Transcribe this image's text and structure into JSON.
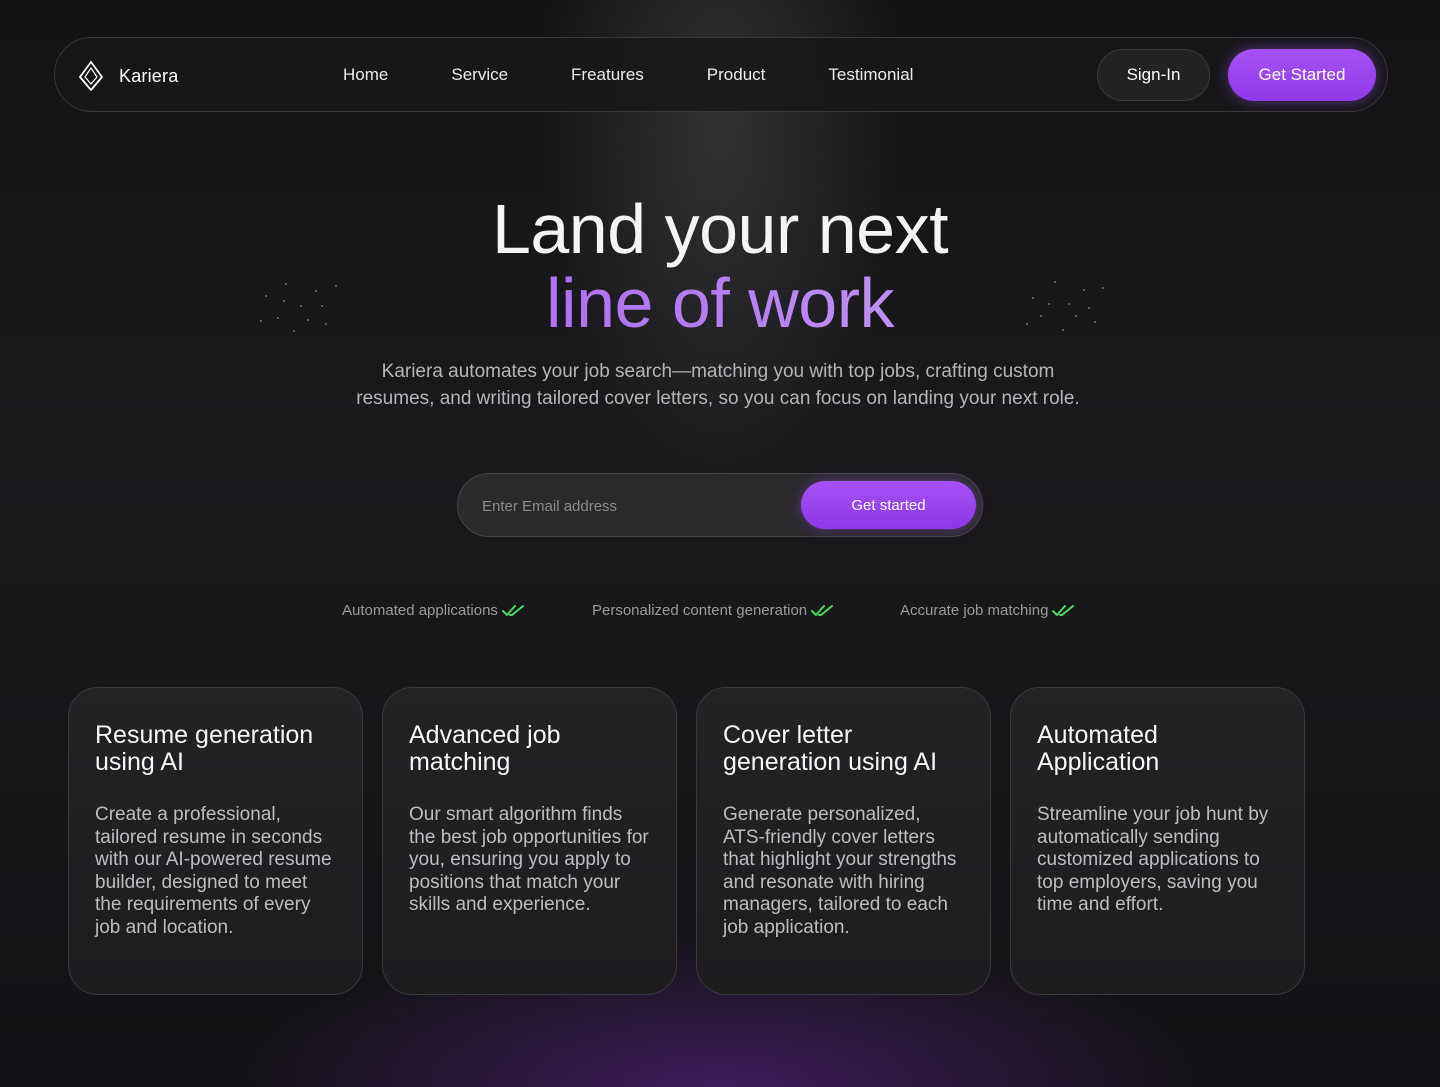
{
  "brand": {
    "name": "Kariera",
    "logo_icon": "diamond-logo-icon"
  },
  "nav": {
    "links": [
      "Home",
      "Service",
      "Freatures",
      "Product",
      "Testimonial"
    ],
    "signin_label": "Sign-In",
    "cta_label": "Get Started"
  },
  "hero": {
    "title_line1": "Land your next",
    "title_line2": "line of work",
    "subtitle": "Kariera automates your job search—matching you with top jobs, crafting custom resumes, and writing tailored cover letters, so you can focus on landing your next role.",
    "email_placeholder": "Enter Email address",
    "email_value": "",
    "submit_label": "Get started"
  },
  "features": [
    {
      "label": "Automated applications",
      "icon": "double-check-icon"
    },
    {
      "label": "Personalized content generation",
      "icon": "double-check-icon"
    },
    {
      "label": "Accurate job matching",
      "icon": "double-check-icon"
    }
  ],
  "cards": [
    {
      "title": "Resume generation using AI",
      "body": "Create a professional, tailored resume in seconds with our AI-powered resume builder, designed to meet the requirements of every job and location."
    },
    {
      "title": "Advanced job matching",
      "body": "Our smart algorithm finds the best job opportunities for you, ensuring you apply to positions that match your skills and experience."
    },
    {
      "title": "Cover letter generation using AI",
      "body": "Generate personalized, ATS-friendly cover letters that highlight your strengths and resonate with hiring managers, tailored to each job application."
    },
    {
      "title": "Automated Application",
      "body": "Streamline your job hunt by automatically sending customized applications to top employers, saving you time and effort."
    }
  ],
  "colors": {
    "accent": "#9b4cf2",
    "check": "#4cd964",
    "background": "#141316"
  }
}
